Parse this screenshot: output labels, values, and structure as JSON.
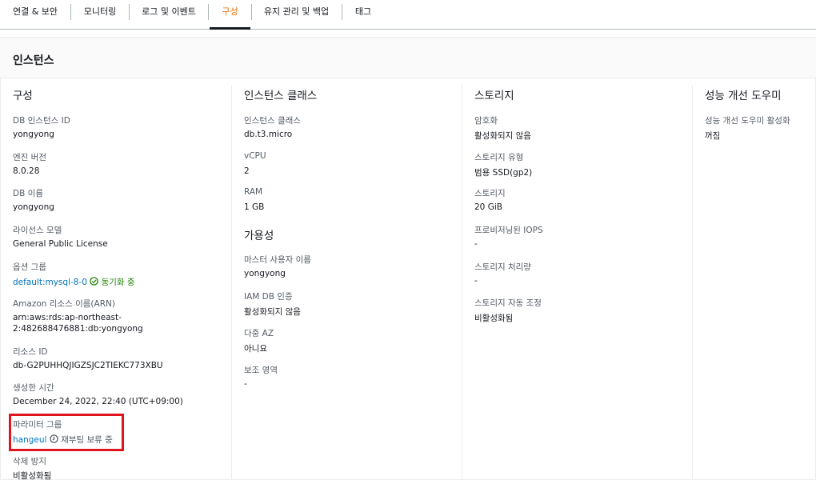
{
  "tabs": [
    {
      "label": "연결 & 보안"
    },
    {
      "label": "모니터링"
    },
    {
      "label": "로그 및 이벤트"
    },
    {
      "label": "구성"
    },
    {
      "label": "유지 관리 및 백업"
    },
    {
      "label": "태그"
    }
  ],
  "panel_title": "인스턴스",
  "config": {
    "title": "구성",
    "db_id": {
      "label": "DB 인스턴스 ID",
      "value": "yongyong"
    },
    "engine": {
      "label": "엔진 버전",
      "value": "8.0.28"
    },
    "db_name": {
      "label": "DB 이름",
      "value": "yongyong"
    },
    "license": {
      "label": "라이선스 모델",
      "value": "General Public License"
    },
    "option_group": {
      "label": "옵션 그룹",
      "value": "default:mysql-8-0",
      "status": "동기화 중"
    },
    "arn": {
      "label": "Amazon 리소스 이름(ARN)",
      "line1": "arn:aws:rds:ap-northeast-",
      "line2": "2:482688476881:db:yongyong"
    },
    "resource_id": {
      "label": "리소스 ID",
      "value": "db-G2PUHHQJIGZSJC2TIEKC773XBU"
    },
    "created": {
      "label": "생성한 시간",
      "value": "December 24, 2022, 22:40 (UTC+09:00)"
    },
    "param_group": {
      "label": "파라미터 그룹",
      "value": "hangeul",
      "status": "재부팅 보류 중"
    },
    "deletion": {
      "label": "삭제 방지",
      "value": "비활성화됨"
    }
  },
  "instance_class": {
    "title": "인스턴스 클래스",
    "cls": {
      "label": "인스턴스 클래스",
      "value": "db.t3.micro"
    },
    "vcpu": {
      "label": "vCPU",
      "value": "2"
    },
    "ram": {
      "label": "RAM",
      "value": "1 GB"
    }
  },
  "availability": {
    "title": "가용성",
    "master": {
      "label": "마스터 사용자 이름",
      "value": "yongyong"
    },
    "iam": {
      "label": "IAM DB 인증",
      "value": "활성화되지 않음"
    },
    "multi_az": {
      "label": "다중 AZ",
      "value": "아니요"
    },
    "secondary": {
      "label": "보조 영역",
      "value": "-"
    }
  },
  "storage": {
    "title": "스토리지",
    "encryption": {
      "label": "암호화",
      "value": "활성화되지 않음"
    },
    "type": {
      "label": "스토리지 유형",
      "value": "범용 SSD(gp2)"
    },
    "size": {
      "label": "스토리지",
      "value": "20 GiB"
    },
    "iops": {
      "label": "프로비저닝된 IOPS",
      "value": "-"
    },
    "throughput": {
      "label": "스토리지 처리량",
      "value": "-"
    },
    "autoscaling": {
      "label": "스토리지 자동 조정",
      "value": "비활성화됨"
    }
  },
  "performance": {
    "title": "성능 개선 도우미",
    "enabled": {
      "label": "성능 개선 도우미 활성화",
      "value": "꺼짐"
    }
  },
  "colors": {
    "accent": "#ec7211",
    "link": "#0073bb",
    "success": "#1d8102",
    "highlight": "#e0141e"
  },
  "icons": {
    "sync_status": "check-circle-icon",
    "pending_status": "clock-icon"
  }
}
